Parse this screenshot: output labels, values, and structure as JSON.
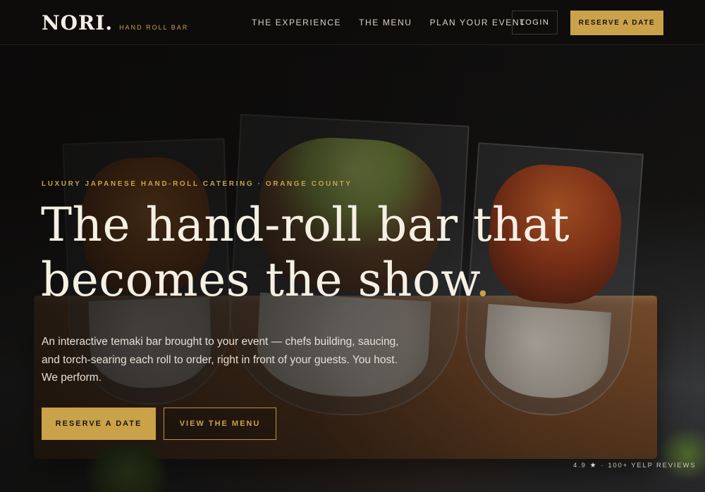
{
  "brand": {
    "name": "NORI",
    "dot": ".",
    "tagline": "HAND ROLL BAR"
  },
  "nav": {
    "items": [
      {
        "label": "THE EXPERIENCE"
      },
      {
        "label": "THE MENU"
      },
      {
        "label": "PLAN YOUR EVENT"
      }
    ],
    "login_label": "LOGIN",
    "reserve_label": "RESERVE A DATE"
  },
  "hero": {
    "eyebrow": "LUXURY JAPANESE HAND-ROLL CATERING · ORANGE COUNTY",
    "headline_line1": "The hand-roll bar that",
    "headline_line2": "becomes the show",
    "headline_dot": ".",
    "lede": "An interactive temaki bar brought to your event — chefs building, saucing, and torch-searing each roll to order, right in front of your guests. You host. We perform.",
    "primary_cta": "RESERVE A DATE",
    "secondary_cta": "VIEW THE MENU"
  },
  "rating": {
    "score": "4.9",
    "star_icon": "star-icon",
    "separator": "·",
    "reviews": "100+ YELP REVIEWS"
  },
  "colors": {
    "accent": "#c9a24a",
    "background": "#0e0d0c",
    "text": "#f5efe4"
  }
}
